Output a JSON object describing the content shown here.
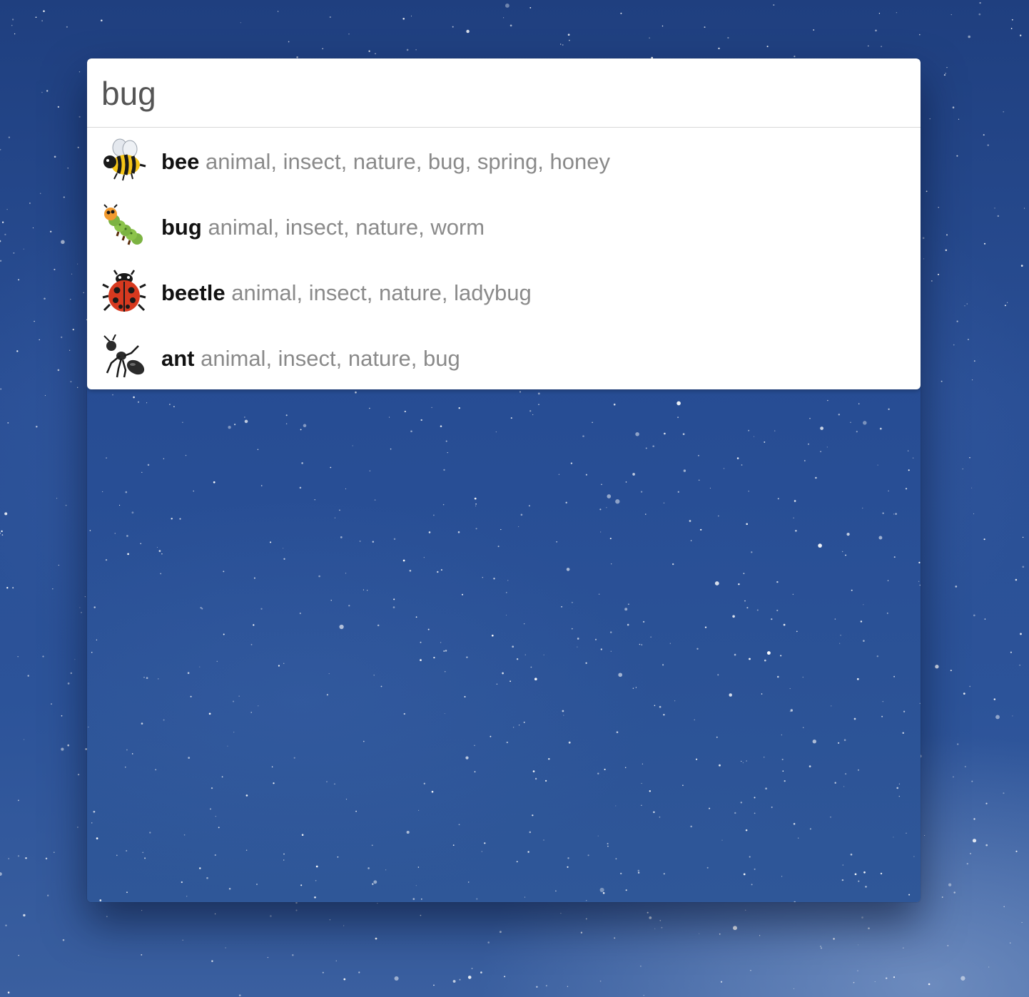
{
  "search": {
    "value": "bug",
    "placeholder": ""
  },
  "results": [
    {
      "name": "bee",
      "keywords": "animal, insect, nature, bug, spring, honey",
      "icon": "bee-icon"
    },
    {
      "name": "bug",
      "keywords": "animal, insect, nature, worm",
      "icon": "caterpillar-icon"
    },
    {
      "name": "beetle",
      "keywords": "animal, insect, nature, ladybug",
      "icon": "ladybug-icon"
    },
    {
      "name": "ant",
      "keywords": "animal, insect, nature, bug",
      "icon": "ant-icon"
    }
  ],
  "colors": {
    "background_sky": "#2a4f95",
    "panel": "#ffffff",
    "result_name": "#111111",
    "result_keywords": "#8a8a8a",
    "search_text": "#555555"
  }
}
